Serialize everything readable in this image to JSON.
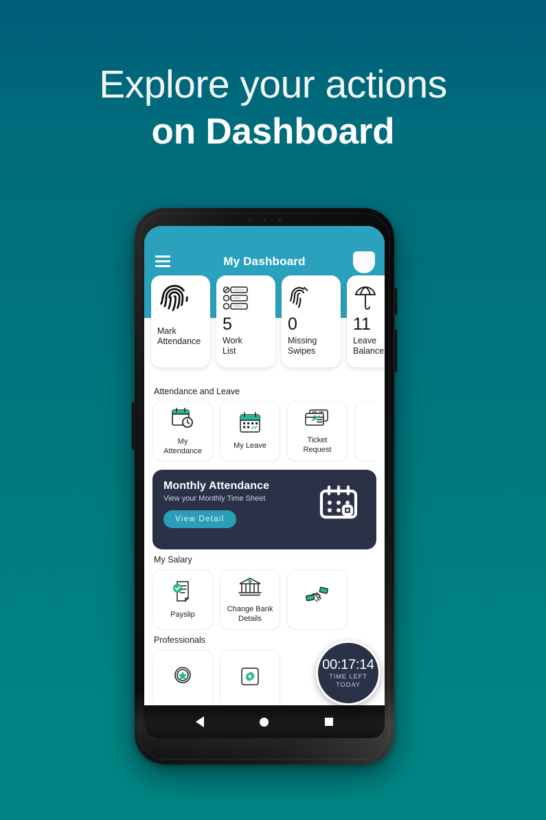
{
  "promo": {
    "line1": "Explore your actions",
    "line2": "on Dashboard"
  },
  "colors": {
    "bg_top": "#005c78",
    "bg_bottom": "#008584",
    "header_teal": "#2aa2bd",
    "banner_navy": "#2b3147",
    "accent_green": "#24b894",
    "button_teal": "#2a9db8"
  },
  "app": {
    "header": {
      "title": "My Dashboard",
      "menu_icon": "hamburger-menu-icon",
      "avatar_icon": "user-avatar"
    },
    "stat_cards": [
      {
        "icon": "fingerprint-icon",
        "count": "",
        "label": "Mark\nAttendance",
        "label_line1": "Mark",
        "label_line2": "Attendance"
      },
      {
        "icon": "checklist-icon",
        "count": "5",
        "label_line1": "Work",
        "label_line2": "List"
      },
      {
        "icon": "broken-fingerprint-icon",
        "count": "0",
        "label_line1": "Missing",
        "label_line2": "Swipes"
      },
      {
        "icon": "beach-umbrella-icon",
        "count": "11",
        "label_line1": "Leave",
        "label_line2": "Balance"
      }
    ],
    "sections": [
      {
        "title": "Attendance and Leave",
        "tiles": [
          {
            "icon": "calendar-clock-icon",
            "label_line1": "My",
            "label_line2": "Attendance"
          },
          {
            "icon": "calendar-icon",
            "label_line1": "My Leave",
            "label_line2": ""
          },
          {
            "icon": "ticket-icon",
            "label_line1": "Ticket",
            "label_line2": "Request"
          },
          {
            "icon": "more-icon",
            "label_line1": "",
            "label_line2": ""
          }
        ]
      },
      {
        "title": "My Salary",
        "tiles": [
          {
            "icon": "payslip-check-icon",
            "label_line1": "Payslip",
            "label_line2": ""
          },
          {
            "icon": "bank-icon",
            "label_line1": "Change Bank",
            "label_line2": "Details"
          },
          {
            "icon": "money-handshake-icon",
            "label_line1": "",
            "label_line2": ""
          }
        ]
      },
      {
        "title": "Professionals",
        "tiles": [
          {
            "icon": "badge-star-icon",
            "label_line1": "",
            "label_line2": ""
          },
          {
            "icon": "gear-icon",
            "label_line1": "",
            "label_line2": ""
          }
        ]
      }
    ],
    "banner": {
      "title": "Monthly Attendance",
      "subtitle": "View your Monthly Time Sheet",
      "button_label": "View Detail",
      "icon": "calendar-grid-icon"
    },
    "timer": {
      "value": "00:17:14",
      "line1": "TIME LEFT",
      "line2": "TODAY"
    },
    "nav": {
      "back_icon": "nav-back-triangle-icon",
      "home_icon": "nav-home-circle-icon",
      "recents_icon": "nav-recents-square-icon"
    }
  }
}
